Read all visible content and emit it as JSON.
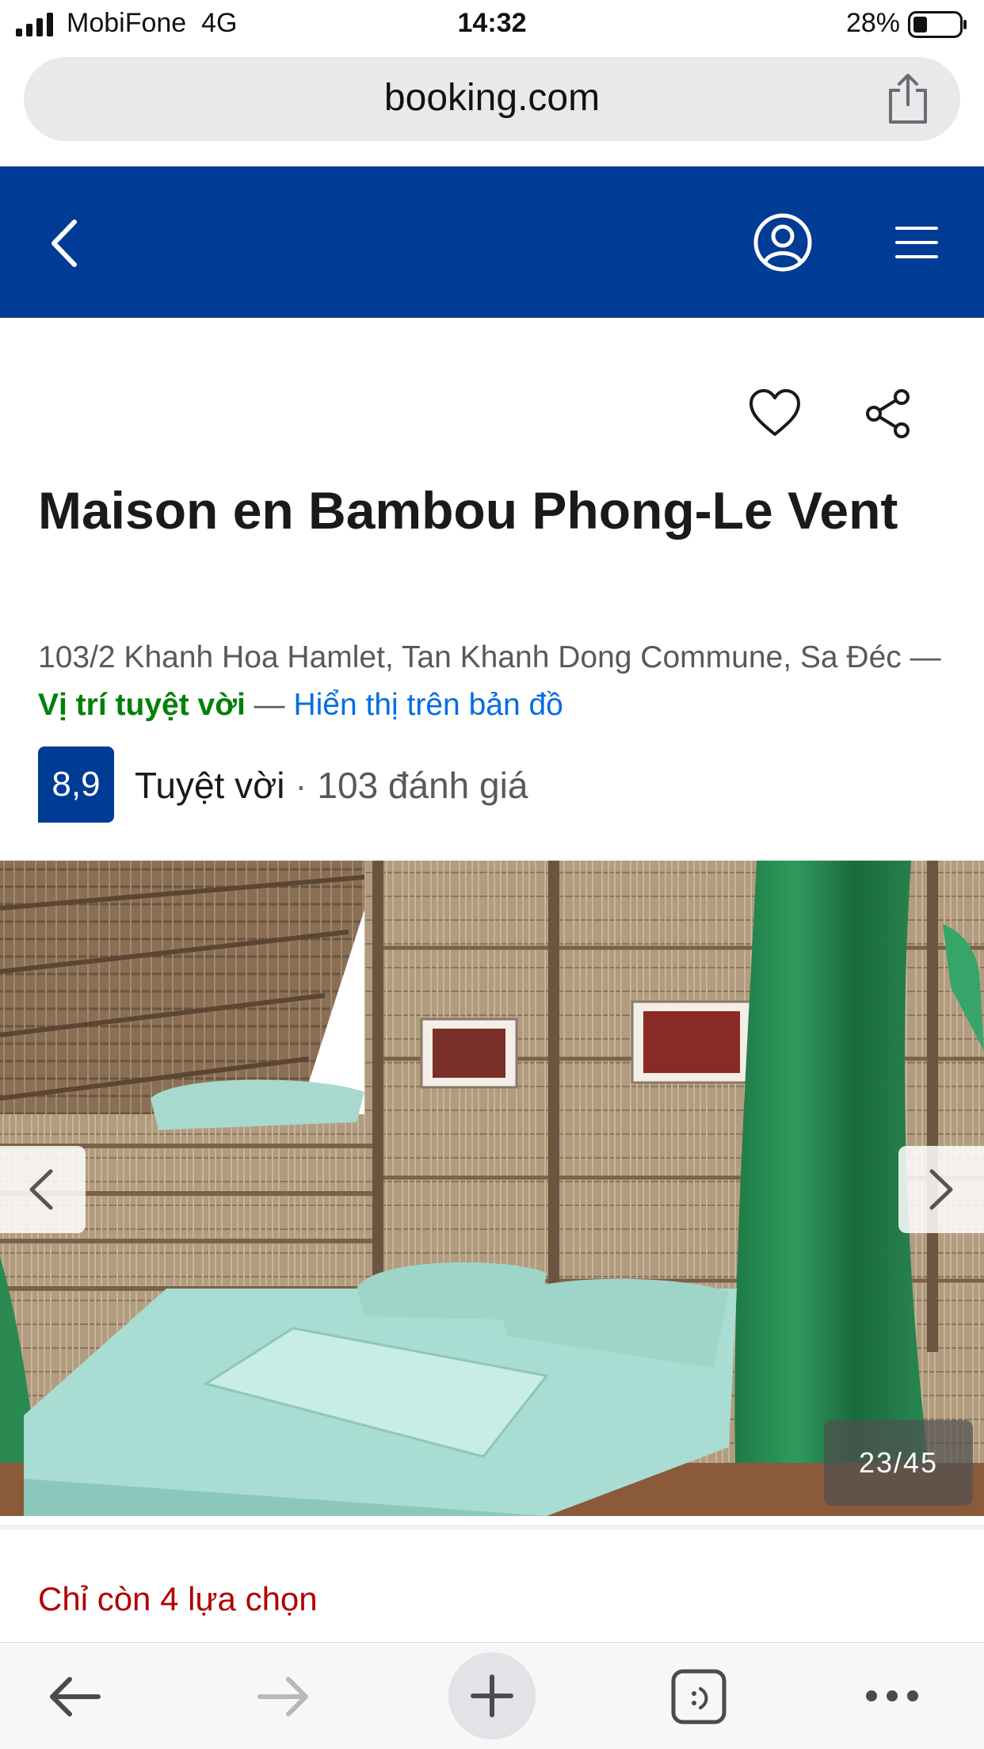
{
  "status_bar": {
    "carrier": "MobiFone",
    "network": "4G",
    "time": "14:32",
    "battery": "28%"
  },
  "browser": {
    "url": "booking.com"
  },
  "property": {
    "name": "Maison en Bambou Phong-Le Vent",
    "address": "103/2 Khanh Hoa Hamlet, Tan Khanh Dong Commune, Sa Đéc",
    "separator": " — ",
    "location_label": "Vị trí tuyệt vời",
    "map_link": "Hiển thị trên bản đồ",
    "score": "8,9",
    "rating_word": "Tuyệt vời",
    "rating_dot": " · ",
    "reviews": "103 đánh giá",
    "photo_counter": "23/45",
    "availability": "Chỉ còn 4 lựa chọn"
  },
  "colors": {
    "brand_blue": "#003b95",
    "link_blue": "#006ce4",
    "good_green": "#008009",
    "urgent_red": "#b10000"
  },
  "icons": {
    "back": "chevron-left-icon",
    "account": "user-circle-icon",
    "menu": "hamburger-icon",
    "favorite": "heart-icon",
    "share": "share-nodes-icon",
    "browser_share": "share-upload-icon"
  }
}
